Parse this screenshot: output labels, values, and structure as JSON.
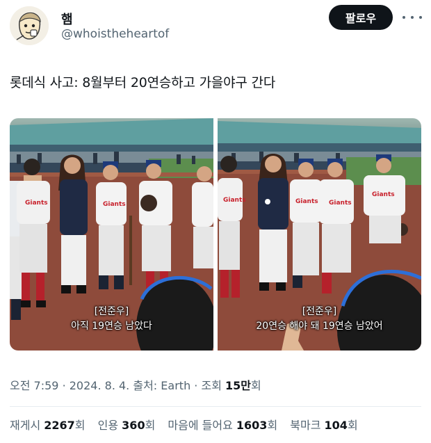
{
  "user": {
    "display_name": "햄",
    "handle": "@whoistheheartof",
    "avatar_icon": "cartoon-face-avatar"
  },
  "header": {
    "follow_label": "팔로우",
    "more_icon": "more-icon"
  },
  "tweet": {
    "text": "롯데식 사고: 8월부터 20연승하고 가을야구 간다"
  },
  "media": {
    "left": {
      "caption_line1": "[전준우]",
      "caption_line2": "아직 19연승 남았다"
    },
    "right": {
      "caption_line1": "[전준우]",
      "caption_line2": "20연승 해야 돼 19연승 남았어"
    },
    "jersey_text": "Giants"
  },
  "meta": {
    "time": "오전 7:59",
    "date": "2024. 8. 4.",
    "source_prefix": "출처:",
    "source": "Earth",
    "views_prefix": "조회",
    "views": "15만",
    "views_suffix": "회",
    "sep": "·"
  },
  "stats": {
    "retweets_label": "재게시",
    "retweets_value": "2267",
    "quotes_label": "인용",
    "quotes_value": "360",
    "likes_label": "마음에 들어요",
    "likes_value": "1603",
    "bookmarks_label": "북마크",
    "bookmarks_value": "104",
    "unit": "회"
  }
}
